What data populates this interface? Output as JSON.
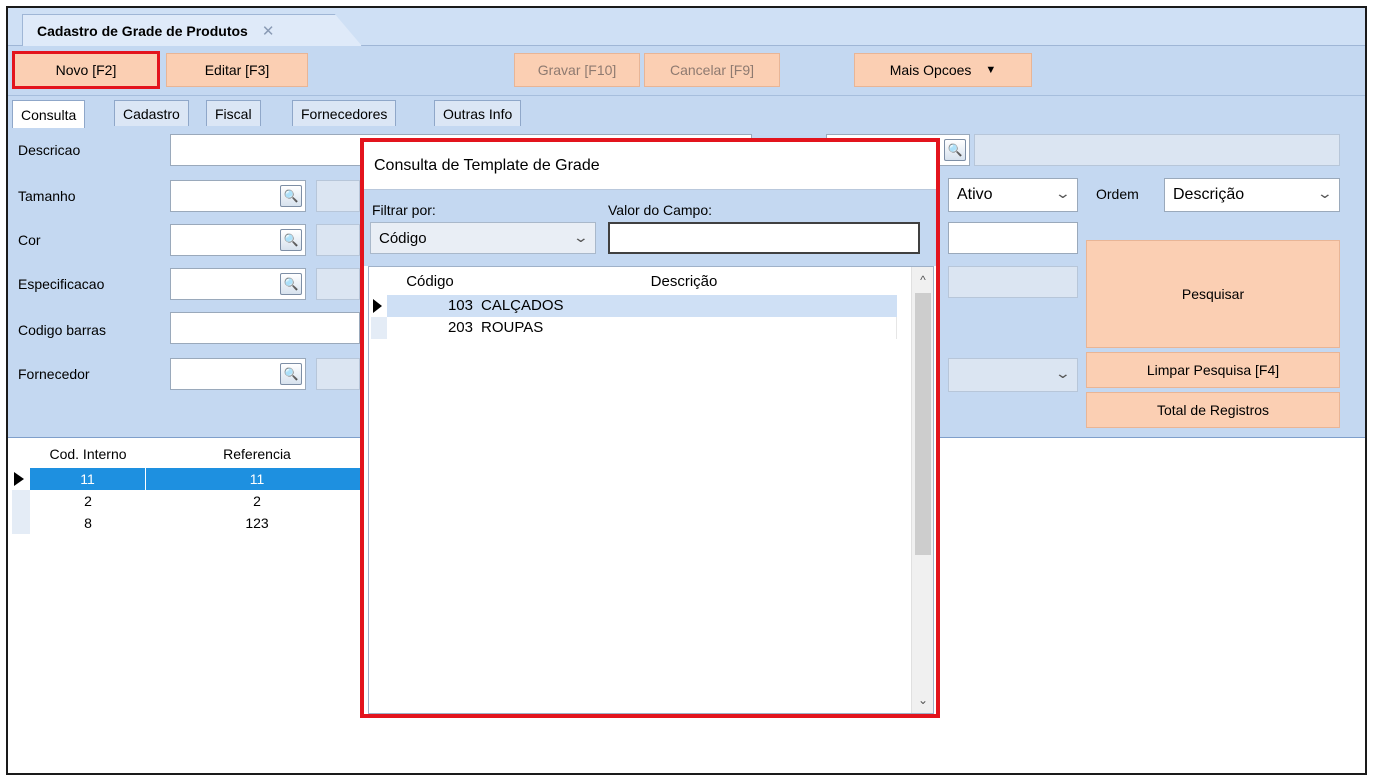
{
  "document_tab": {
    "title": "Cadastro de Grade de Produtos",
    "close": "✕"
  },
  "toolbar": {
    "novo": "Novo [F2]",
    "editar": "Editar [F3]",
    "gravar": "Gravar [F10]",
    "cancelar": "Cancelar [F9]",
    "mais_opcoes": "Mais Opcoes",
    "mais_caret": "▼"
  },
  "tabs": [
    "Consulta",
    "Cadastro",
    "Fiscal",
    "Fornecedores",
    "Outras Info"
  ],
  "form": {
    "descricao": "Descricao",
    "tamanho": "Tamanho",
    "cor": "Cor",
    "especificacao": "Especificacao",
    "codigo_barras": "Codigo barras",
    "fornecedor": "Fornecedor",
    "status_value": "Ativo",
    "ordem_label": "Ordem",
    "ordem_value": "Descrição",
    "chevron": "⌄"
  },
  "actions": {
    "pesquisar": "Pesquisar",
    "limpar": "Limpar Pesquisa [F4]",
    "total": "Total de Registros"
  },
  "grid": {
    "columns": [
      "Cod. Interno",
      "Referencia"
    ],
    "rows": [
      {
        "cod": "11",
        "ref": "11"
      },
      {
        "cod": "2",
        "ref": "2"
      },
      {
        "cod": "8",
        "ref": "123"
      }
    ]
  },
  "dialog": {
    "title": "Consulta de Template de Grade",
    "filtrar_label": "Filtrar por:",
    "filtrar_value": "Código",
    "valor_label": "Valor do Campo:",
    "valor_value": "",
    "columns": [
      "Código",
      "Descrição"
    ],
    "rows": [
      {
        "codigo": "103",
        "descricao": "CALÇADOS"
      },
      {
        "codigo": "203",
        "descricao": "ROUPAS"
      }
    ],
    "scroll_up": "^",
    "scroll_down": "⌄"
  },
  "colors": {
    "accent_red": "#e3141d",
    "button_peach": "#fbcfb3",
    "panel_blue": "#c4d8f1",
    "selection_blue": "#1e90e0"
  },
  "icons": {
    "lookup": "magnifier-icon",
    "row_pointer": "triangle-right-icon"
  }
}
